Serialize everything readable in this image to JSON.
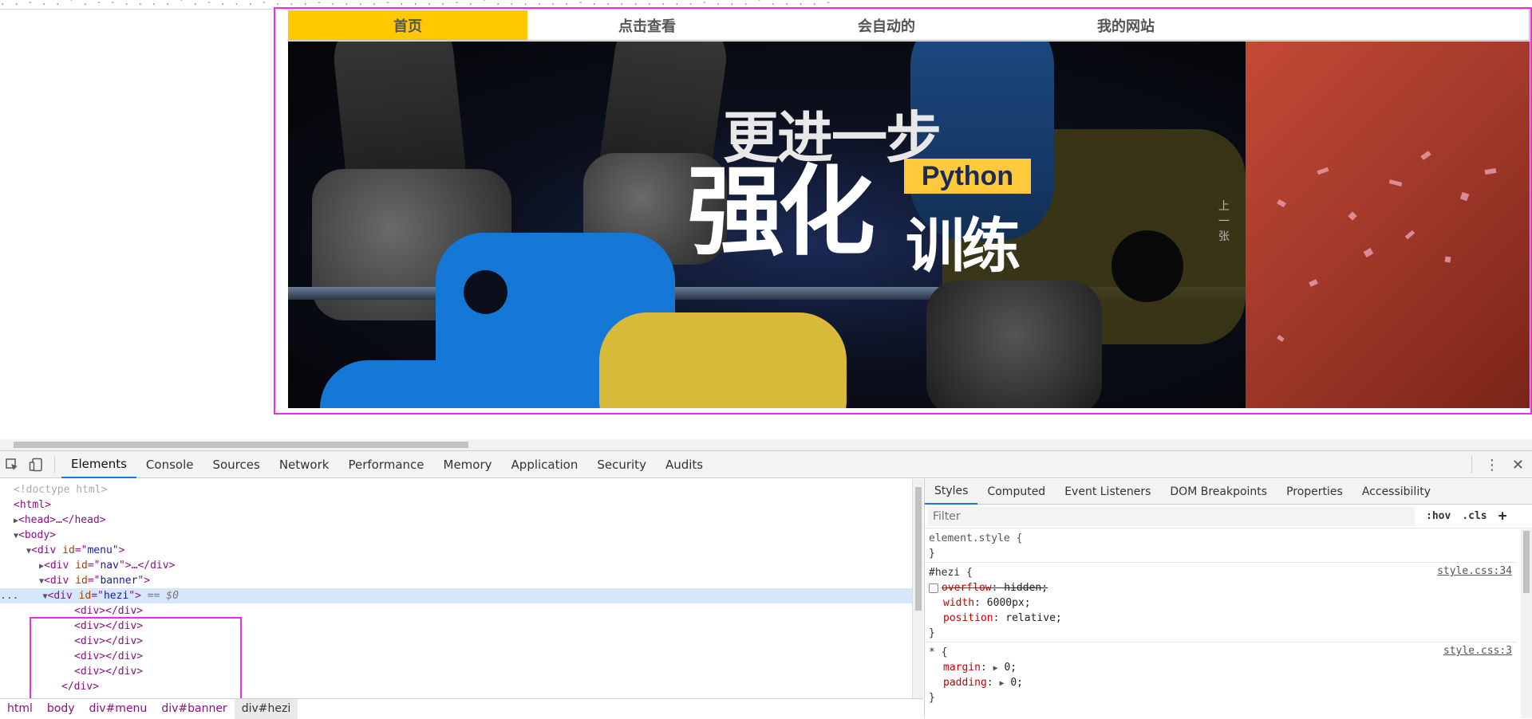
{
  "nav": {
    "items": [
      {
        "label": "首页",
        "active": true
      },
      {
        "label": "点击查看",
        "active": false
      },
      {
        "label": "会自动的",
        "active": false
      },
      {
        "label": "我的网站",
        "active": false
      }
    ]
  },
  "banner": {
    "headline_line1": "更进一步",
    "headline_line2": "强化",
    "headline_line3": "训练",
    "badge": "Python",
    "prev_control": "上一张"
  },
  "devtools": {
    "tabs": [
      "Elements",
      "Console",
      "Sources",
      "Network",
      "Performance",
      "Memory",
      "Application",
      "Security",
      "Audits"
    ],
    "active_tab": "Elements",
    "dom": {
      "doctype": "<!doctype html>",
      "html_open": "<html>",
      "head": "<head>…</head>",
      "body_open": "<body>",
      "menu_id": "menu",
      "nav_id": "nav",
      "banner_id": "banner",
      "hezi_id": "hezi",
      "selected_marker": "== $0",
      "child_div": "<div></div>",
      "close_div": "</div>",
      "ellipsis": "..."
    },
    "breadcrumb": [
      "html",
      "body",
      "div#menu",
      "div#banner",
      "div#hezi"
    ],
    "styles_tabs": [
      "Styles",
      "Computed",
      "Event Listeners",
      "DOM Breakpoints",
      "Properties",
      "Accessibility"
    ],
    "filter_placeholder": "Filter",
    "hov_label": ":hov",
    "cls_label": ".cls",
    "add_label": "+",
    "rules": {
      "element_style": "element.style {",
      "close_brace": "}",
      "hezi_selector": "#hezi {",
      "hezi_source": "style.css:34",
      "overflow_prop": "overflow",
      "overflow_val": "hidden;",
      "width_prop": "width",
      "width_val": "6000px;",
      "position_prop": "position",
      "position_val": "relative;",
      "star_selector": "* {",
      "star_source": "style.css:3",
      "margin_prop": "margin",
      "margin_val": "0;",
      "padding_prop": "padding",
      "padding_val": "0;"
    }
  },
  "colors": {
    "nav_active": "#ffc800",
    "highlight_border": "#e930e0",
    "python_badge": "#ffc93b",
    "devtools_accent": "#1a73e8"
  }
}
